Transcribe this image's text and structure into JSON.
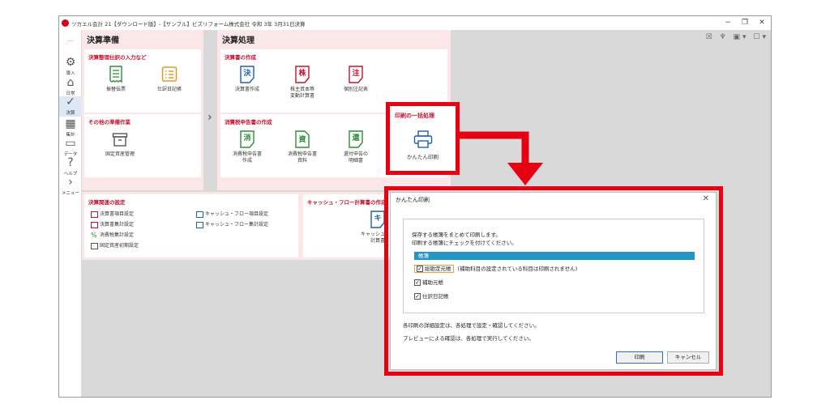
{
  "window": {
    "title": "ツカエル会計 21【ダウンロード版】-【サンプル】ビズリフォーム株式会社 令和 3年 3月31日決算",
    "minimize": "−",
    "maximize": "❐",
    "close": "✕"
  },
  "sidebar": {
    "more": "…",
    "items": [
      {
        "label": "導入",
        "icon": "⚙"
      },
      {
        "label": "日常",
        "icon": "⌂"
      },
      {
        "label": "決算",
        "icon": "✓"
      },
      {
        "label": "集計",
        "icon": "▦"
      },
      {
        "label": "データ",
        "icon": "▭"
      },
      {
        "label": "ヘルプ",
        "icon": "?"
      },
      {
        "label": "メニュー",
        "icon": "›"
      }
    ]
  },
  "toolbar": {
    "icons": "☒ ♆ ▣▾ ☐▾"
  },
  "prep": {
    "title": "決算準備",
    "adjust": {
      "title": "決算整理仕訳の入力など",
      "tiles": [
        {
          "label": "振替伝票"
        },
        {
          "label": "仕訳日記帳"
        }
      ]
    },
    "other": {
      "title": "その他の準備作業",
      "tiles": [
        {
          "label": "固定資産管理"
        }
      ]
    }
  },
  "proc": {
    "title": "決算処理",
    "docs": {
      "title": "決算書の作成",
      "tiles": [
        {
          "glyph": "決",
          "label": "決算書作成",
          "label2": ""
        },
        {
          "glyph": "株",
          "label": "株主資本等",
          "label2": "変動計算書"
        },
        {
          "glyph": "注",
          "label": "個別注記表",
          "label2": ""
        }
      ]
    },
    "tax": {
      "title": "消費税申告書の作成",
      "tiles": [
        {
          "glyph": "消",
          "label": "消費税申告書",
          "label2": "作成"
        },
        {
          "glyph": "資",
          "label": "消費税申告書",
          "label2": "資料"
        },
        {
          "glyph": "還",
          "label": "還付申告の",
          "label2": "明細書"
        }
      ]
    }
  },
  "related": {
    "title": "決算関連の設定",
    "links": [
      "決算書項目設定",
      "決算書集計設定",
      "消費税集計設定",
      "固定資産初期設定",
      "キャッシュ・フロー項目設定",
      "キャッシュ・フロー集計設定"
    ]
  },
  "cashflow": {
    "title": "キャッシュ・フロー計算書の作成",
    "glyph": "キ",
    "label": "キャッシュ・フ",
    "label2": "計算書"
  },
  "bulk": {
    "title": "印刷の一括処理",
    "label": "かんたん印刷"
  },
  "dialog": {
    "title": "かんたん印刷",
    "close": "✕",
    "msg1": "保存する帳簿をまとめて印刷します。",
    "msg2": "印刷する帳簿にチェックを付けてください。",
    "ledger_header": "帳簿",
    "options": [
      {
        "label": "総勘定元帳",
        "note": "(補助科目の設定されている科目は印刷されません)"
      },
      {
        "label": "補助元帳",
        "note": ""
      },
      {
        "label": "仕訳日記帳",
        "note": ""
      }
    ],
    "check_mark": "✓",
    "note1": "各印刷の詳細設定は、各処理で設定・確認してください。",
    "note2": "プレビューによる確認は、各処理で実行してください。",
    "print_button": "印刷",
    "cancel_button": "キャンセル"
  },
  "colors": {
    "accent_red": "#e60012",
    "header_blue": "#2396c4",
    "panel_pink": "#fbe7e7"
  }
}
